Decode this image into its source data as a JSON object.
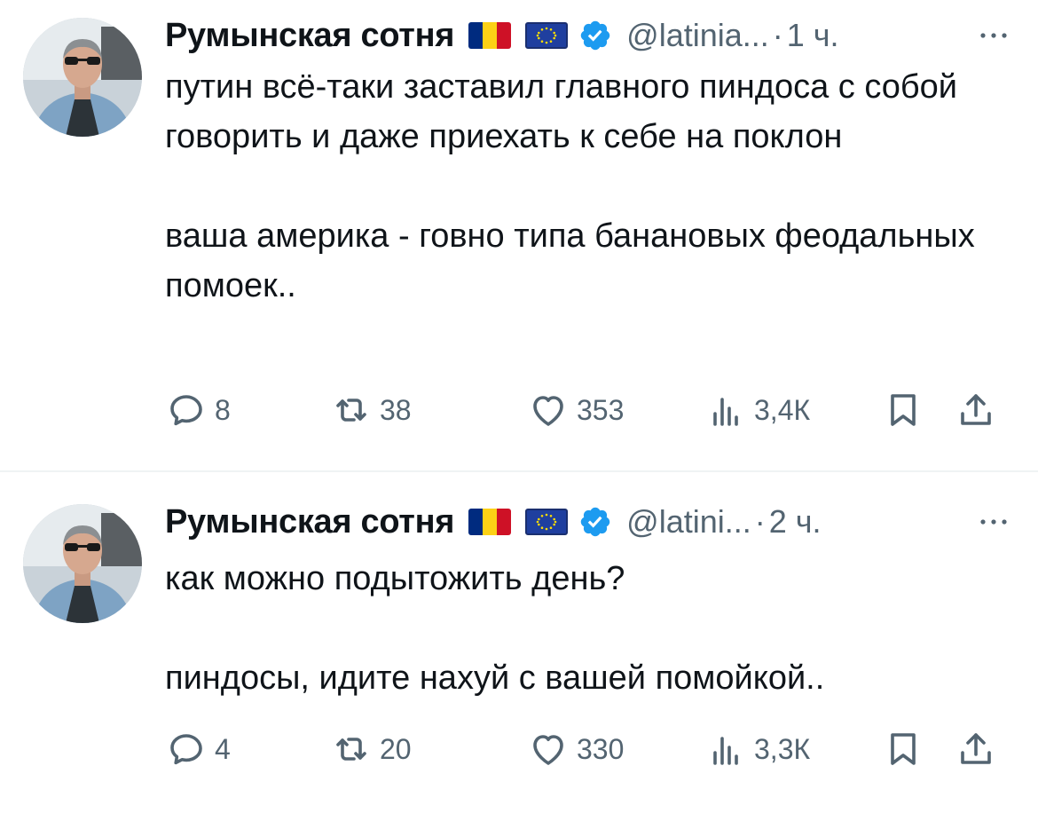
{
  "tweets": [
    {
      "author": {
        "name": "Румынская сотня",
        "handle": "@latinia...",
        "flags": [
          "ro-flag",
          "eu-flag"
        ],
        "verified": true
      },
      "separator": "·",
      "time": "1 ч.",
      "text": "путин всё-таки заставил главного пиндоса с собой говорить и даже приехать к себе на поклон\n\nваша америка - говно типа банановых феодальных помоек..",
      "stats": {
        "replies": "8",
        "retweets": "38",
        "likes": "353",
        "views": "3,4К"
      }
    },
    {
      "author": {
        "name": "Румынская сотня",
        "handle": "@latini...",
        "flags": [
          "ro-flag",
          "eu-flag"
        ],
        "verified": true
      },
      "separator": "·",
      "time": "2 ч.",
      "text": "как можно подытожить день?\n\nпиндосы, идите нахуй с вашей помойкой..",
      "stats": {
        "replies": "4",
        "retweets": "20",
        "likes": "330",
        "views": "3,3К"
      }
    }
  ],
  "colors": {
    "text": "#0f1419",
    "secondary": "#536471",
    "verified": "#1d9bf0",
    "divider": "#eff3f4"
  },
  "icons": {
    "reply": "reply-icon",
    "retweet": "retweet-icon",
    "like": "heart-icon",
    "views": "views-icon",
    "bookmark": "bookmark-icon",
    "share": "share-icon",
    "more": "more-icon",
    "verified": "verified-badge-icon"
  }
}
